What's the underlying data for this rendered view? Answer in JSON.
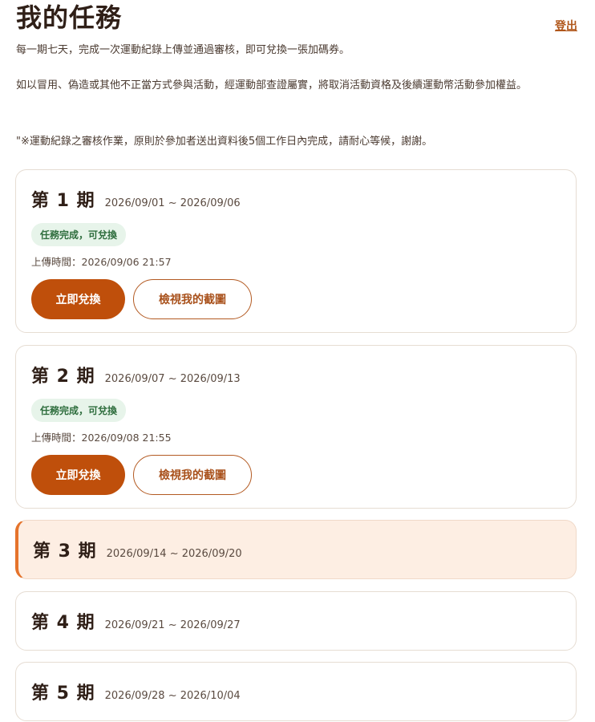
{
  "header": {
    "title": "我的任務",
    "logout": "登出"
  },
  "intro": [
    "每一期七天，完成一次運動紀錄上傳並通過審核，即可兌換一張加碼券。",
    "如以冒用、偽造或其他不正當方式參與活動，經運動部查證屬實，將取消活動資格及後續運動幣活動參加權益。",
    "\"※運動紀錄之審核作業，原則於參加者送出資料後5個工作日內完成，請耐心等候，謝謝。"
  ],
  "periods": [
    {
      "label": "第 1 期",
      "range": "2026/09/01 ~ 2026/09/06",
      "status": "任務完成，可兌換",
      "upload": "上傳時間：2026/09/06 21:57",
      "redeem": "立即兌換",
      "view": "檢視我的截圖"
    },
    {
      "label": "第 2 期",
      "range": "2026/09/07 ~ 2026/09/13",
      "status": "任務完成，可兌換",
      "upload": "上傳時間：2026/09/08 21:55",
      "redeem": "立即兌換",
      "view": "檢視我的截圖"
    },
    {
      "label": "第 3 期",
      "range": "2026/09/14 ~ 2026/09/20"
    },
    {
      "label": "第 4 期",
      "range": "2026/09/21 ~ 2026/09/27"
    },
    {
      "label": "第 5 期",
      "range": "2026/09/28 ~ 2026/10/04"
    }
  ],
  "colors": {
    "accent": "#bf4f0b",
    "active_bg": "#fdeee3",
    "active_border": "#e5732b",
    "badge_bg": "#e7f4ea",
    "badge_text": "#2f6e3e"
  }
}
